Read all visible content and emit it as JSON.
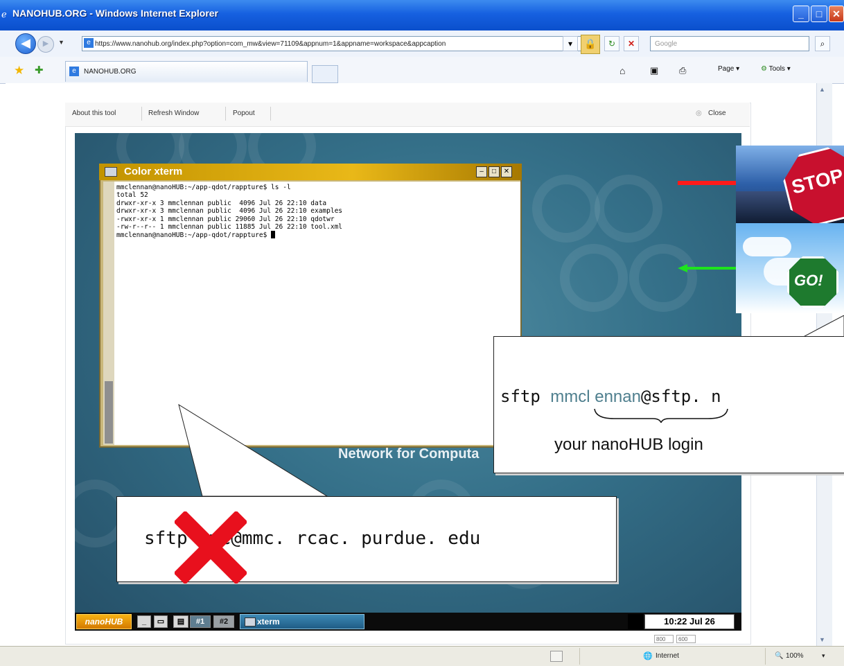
{
  "window": {
    "title": "NANOHUB.ORG - Windows Internet Explorer",
    "address_url": "https://www.nanohub.org/index.php?option=com_mw&view=71109&appnum=1&appname=workspace&appcaption",
    "search_placeholder": "Google",
    "tab_label": "NANOHUB.ORG",
    "command_page": "Page",
    "command_tools": "Tools"
  },
  "tool_toolbar": {
    "about": "About this tool",
    "refresh": "Refresh Window",
    "popout": "Popout",
    "close": "Close"
  },
  "xterm": {
    "title": "Color xterm",
    "lines": [
      "mmclennan@nanoHUB:~/app-qdot/rappture$ ls -l",
      "total 52",
      "drwxr-xr-x 3 mmclennan public  4096 Jul 26 22:10 data",
      "drwxr-xr-x 3 mmclennan public  4096 Jul 26 22:10 examples",
      "-rwxr-xr-x 1 mmclennan public 29060 Jul 26 22:10 qdotwr",
      "-rw-r--r-- 1 mmclennan public 11885 Jul 26 22:10 tool.xml"
    ],
    "prompt": "mmclennan@nanoHUB:~/app-qdot/rappture$ "
  },
  "desktop": {
    "background_text": "Network for Computa"
  },
  "taskbar": {
    "logo": "nanoHUB",
    "ws1": "#1",
    "ws2": "#2",
    "xterm_task": "xterm",
    "clock": "10:22 Jul 26",
    "size_w": "800",
    "size_h": "600"
  },
  "signs": {
    "stop": "STOP",
    "go": "GO!"
  },
  "callout_correct": {
    "cmd": "sftp ",
    "user": "mmcl ennan",
    "host": "@sftp. n",
    "caption": "your nanoHUB login"
  },
  "callout_wrong": {
    "text": "sftp mmc@mmc. rcac. purdue. edu"
  },
  "statusbar": {
    "zone": "Internet",
    "zoom": "100%"
  },
  "colors": {
    "stop_arrow": "#ff1a1a",
    "go_arrow": "#1de41d",
    "cross": "#e8101d",
    "login_user": "#4f7f8e"
  }
}
